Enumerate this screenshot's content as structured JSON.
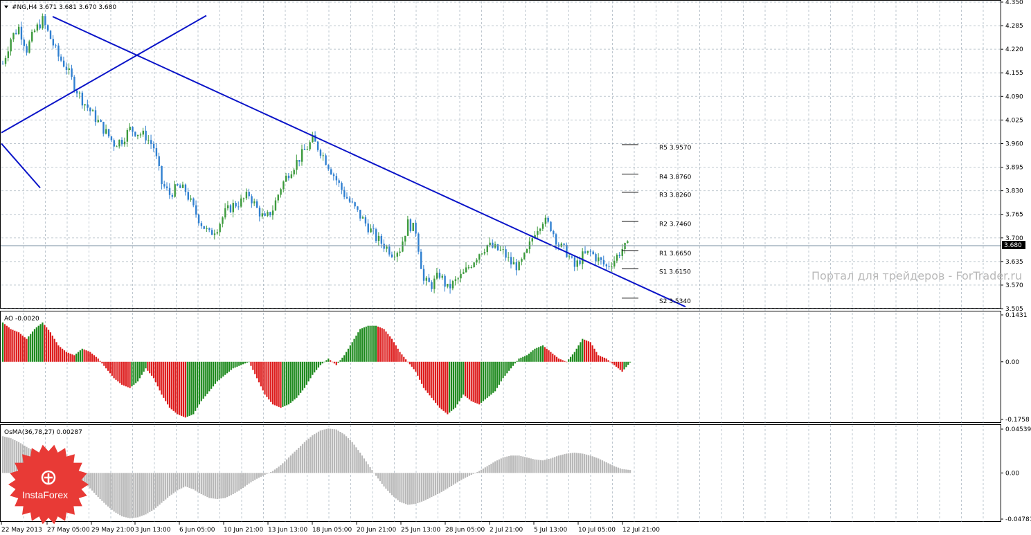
{
  "header": {
    "symbol_line": "#NG,H4  3.671 3.681 3.670 3.680",
    "ao_line": "AO -0.0020",
    "osma_line": "OsMA(36,78,27) 0.00287"
  },
  "watermark": "Портал для трейдеров - ForTrader.ru",
  "logo": {
    "text": "InstaForex",
    "icon": "insta-logo-icon",
    "color": "#e83a36"
  },
  "colors": {
    "up": "#3c9a3c",
    "down": "#2f7fd0",
    "trend": "#0a14c8",
    "ao_up": "#1e8a1e",
    "ao_down": "#dd1a1a",
    "osma": "#b8b8b8",
    "grid": "#8a9aa8"
  },
  "chart_data": [
    {
      "type": "candlestick",
      "title": "#NG,H4",
      "ohlc_last": {
        "open": 3.671,
        "high": 3.681,
        "low": 3.67,
        "close": 3.68
      },
      "current_price_label": "3.680",
      "ylim": [
        3.505,
        4.35
      ],
      "y_ticks": [
        "4.350",
        "4.285",
        "4.220",
        "4.155",
        "4.090",
        "4.025",
        "3.960",
        "3.895",
        "3.830",
        "3.765",
        "3.700",
        "3.635",
        "3.570",
        "3.505"
      ],
      "x_ticks": [
        "22 May 2013",
        "27 May 05:00",
        "29 May 21:00",
        "3 Jun 13:00",
        "6 Jun 05:00",
        "10 Jun 21:00",
        "13 Jun 13:00",
        "18 Jun 05:00",
        "20 Jun 21:00",
        "25 Jun 13:00",
        "28 Jun 05:00",
        "2 Jul 21:00",
        "5 Jul 13:00",
        "10 Jul 05:00",
        "12 Jul 21:00"
      ],
      "close_path": [
        4.18,
        4.25,
        4.28,
        4.22,
        4.27,
        4.3,
        4.25,
        4.2,
        4.17,
        4.12,
        4.08,
        4.05,
        4.02,
        3.99,
        3.96,
        3.97,
        4.0,
        3.99,
        3.98,
        3.95,
        3.85,
        3.82,
        3.84,
        3.83,
        3.78,
        3.74,
        3.71,
        3.73,
        3.77,
        3.79,
        3.8,
        3.82,
        3.78,
        3.75,
        3.78,
        3.84,
        3.88,
        3.91,
        3.94,
        3.97,
        3.94,
        3.9,
        3.86,
        3.82,
        3.79,
        3.76,
        3.73,
        3.7,
        3.68,
        3.66,
        3.67,
        3.74,
        3.72,
        3.58,
        3.57,
        3.6,
        3.56,
        3.58,
        3.6,
        3.63,
        3.66,
        3.68,
        3.67,
        3.66,
        3.63,
        3.62,
        3.66,
        3.72,
        3.75,
        3.73,
        3.68,
        3.66,
        3.62,
        3.65,
        3.66,
        3.64,
        3.62,
        3.64,
        3.67,
        3.68
      ],
      "trendlines": [
        {
          "name": "falling-trendline",
          "points": [
            [
              "27 May 05:00",
              4.31
            ],
            [
              "12 Jul 21:00",
              3.59
            ]
          ]
        },
        {
          "name": "rising-trendline",
          "points": [
            [
              "22 May 2013",
              3.99
            ],
            [
              "3 Jun 13:00",
              4.29
            ]
          ]
        },
        {
          "name": "short-trendline",
          "points": [
            [
              "22 May 2013",
              3.96
            ],
            [
              "27 May 05:00",
              3.88
            ]
          ]
        }
      ],
      "pivots": [
        {
          "label": "R5 3.9570",
          "value": 3.957
        },
        {
          "label": "R4 3.8760",
          "value": 3.876
        },
        {
          "label": "R3 3.8260",
          "value": 3.826
        },
        {
          "label": "R2 3.7460",
          "value": 3.746
        },
        {
          "label": "R1 3.6650",
          "value": 3.665
        },
        {
          "label": "S1 3.6150",
          "value": 3.615
        },
        {
          "label": "S2 3.5340",
          "value": 3.534
        }
      ]
    },
    {
      "type": "bar",
      "title": "AO -0.0020",
      "ylim": [
        -0.1758,
        0.1431
      ],
      "y_ticks": [
        "0.1431",
        "0.00",
        "-0.1758"
      ],
      "values": [
        0.12,
        0.1,
        0.09,
        0.07,
        0.1,
        0.12,
        0.09,
        0.05,
        0.03,
        0.02,
        0.04,
        0.03,
        0.01,
        -0.02,
        -0.05,
        -0.07,
        -0.08,
        -0.06,
        -0.02,
        -0.05,
        -0.1,
        -0.14,
        -0.16,
        -0.17,
        -0.16,
        -0.12,
        -0.09,
        -0.06,
        -0.04,
        -0.02,
        -0.01,
        0.0,
        -0.05,
        -0.1,
        -0.13,
        -0.14,
        -0.13,
        -0.11,
        -0.08,
        -0.04,
        -0.01,
        0.01,
        -0.01,
        0.02,
        0.06,
        0.1,
        0.11,
        0.11,
        0.1,
        0.07,
        0.03,
        0.0,
        -0.03,
        -0.08,
        -0.11,
        -0.14,
        -0.16,
        -0.14,
        -0.1,
        -0.12,
        -0.13,
        -0.11,
        -0.09,
        -0.05,
        -0.02,
        0.01,
        0.02,
        0.04,
        0.05,
        0.03,
        0.01,
        0.0,
        0.03,
        0.07,
        0.06,
        0.02,
        0.01,
        -0.01,
        -0.03,
        -0.002
      ]
    },
    {
      "type": "bar",
      "title": "OsMA(36,78,27) 0.00287",
      "ylim": [
        -0.04781,
        0.04539
      ],
      "y_ticks": [
        "0.04539",
        "0.00",
        "-0.04781"
      ],
      "values": [
        0.038,
        0.036,
        0.032,
        0.027,
        0.022,
        0.018,
        0.013,
        0.008,
        0.003,
        -0.002,
        -0.008,
        -0.016,
        -0.025,
        -0.033,
        -0.04,
        -0.045,
        -0.047,
        -0.046,
        -0.043,
        -0.038,
        -0.031,
        -0.024,
        -0.018,
        -0.014,
        -0.017,
        -0.022,
        -0.026,
        -0.027,
        -0.026,
        -0.022,
        -0.017,
        -0.011,
        -0.006,
        -0.002,
        0.002,
        0.008,
        0.016,
        0.024,
        0.032,
        0.039,
        0.044,
        0.046,
        0.045,
        0.04,
        0.032,
        0.021,
        0.009,
        -0.003,
        -0.014,
        -0.023,
        -0.03,
        -0.033,
        -0.032,
        -0.029,
        -0.025,
        -0.021,
        -0.016,
        -0.011,
        -0.006,
        -0.002,
        0.002,
        0.007,
        0.012,
        0.016,
        0.018,
        0.018,
        0.016,
        0.014,
        0.013,
        0.015,
        0.018,
        0.02,
        0.021,
        0.02,
        0.018,
        0.015,
        0.011,
        0.007,
        0.004,
        0.003
      ]
    }
  ]
}
